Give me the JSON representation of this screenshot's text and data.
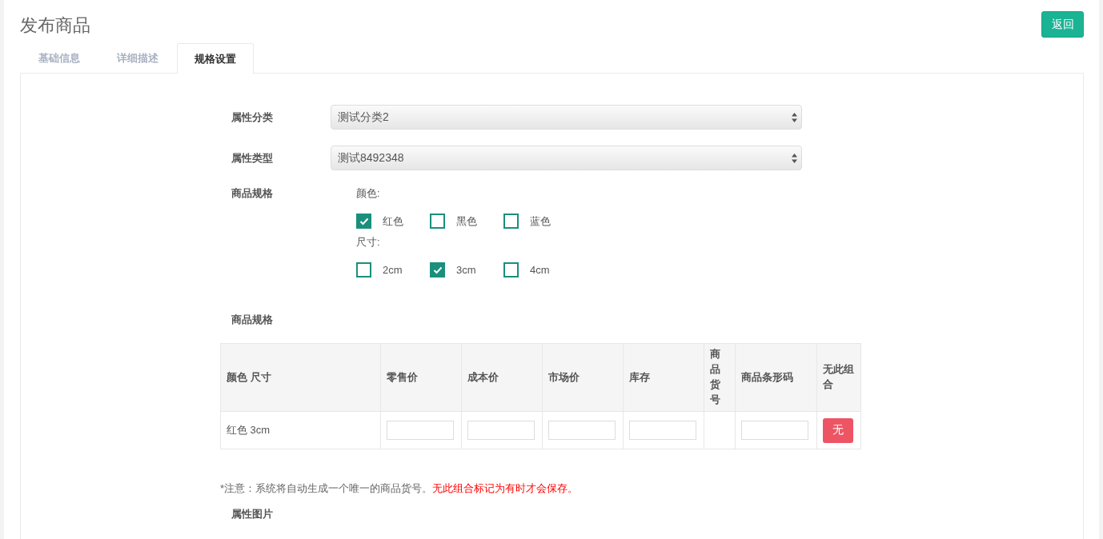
{
  "title": "发布商品",
  "back_button": "返回",
  "tabs": [
    {
      "label": "基础信息",
      "selected": false
    },
    {
      "label": "详细描述",
      "selected": false
    },
    {
      "label": "规格设置",
      "selected": true
    }
  ],
  "selects": [
    {
      "label": "属性分类",
      "value": "测试分类2"
    },
    {
      "label": "属性类型",
      "value": "测试8492348"
    }
  ],
  "spec": {
    "label": "商品规格",
    "groups": [
      {
        "name": "颜色:",
        "options": [
          {
            "label": "红色",
            "checked": true
          },
          {
            "label": "黑色",
            "checked": false
          },
          {
            "label": "蓝色",
            "checked": false
          }
        ]
      },
      {
        "name": "尺寸:",
        "options": [
          {
            "label": "2cm",
            "checked": false
          },
          {
            "label": "3cm",
            "checked": true
          },
          {
            "label": "4cm",
            "checked": false
          }
        ]
      }
    ]
  },
  "table_label": "商品规格",
  "table": {
    "columns": [
      "颜色 尺寸",
      "零售价",
      "成本价",
      "市场价",
      "库存",
      "商品货号",
      "商品条形码",
      "无此组合"
    ],
    "rows": [
      {
        "cells": [
          {
            "kind": "text",
            "text": "红色 3cm"
          },
          {
            "kind": "input"
          },
          {
            "kind": "input"
          },
          {
            "kind": "input"
          },
          {
            "kind": "input"
          },
          {
            "kind": "empty"
          },
          {
            "kind": "input"
          },
          {
            "kind": "button",
            "text": "无"
          }
        ]
      }
    ]
  },
  "note": {
    "text": "*注意：系统将自动生成一个唯一的商品货号。",
    "warning": "无此组合标记为有时才会保存。"
  },
  "images_label": "属性图片"
}
